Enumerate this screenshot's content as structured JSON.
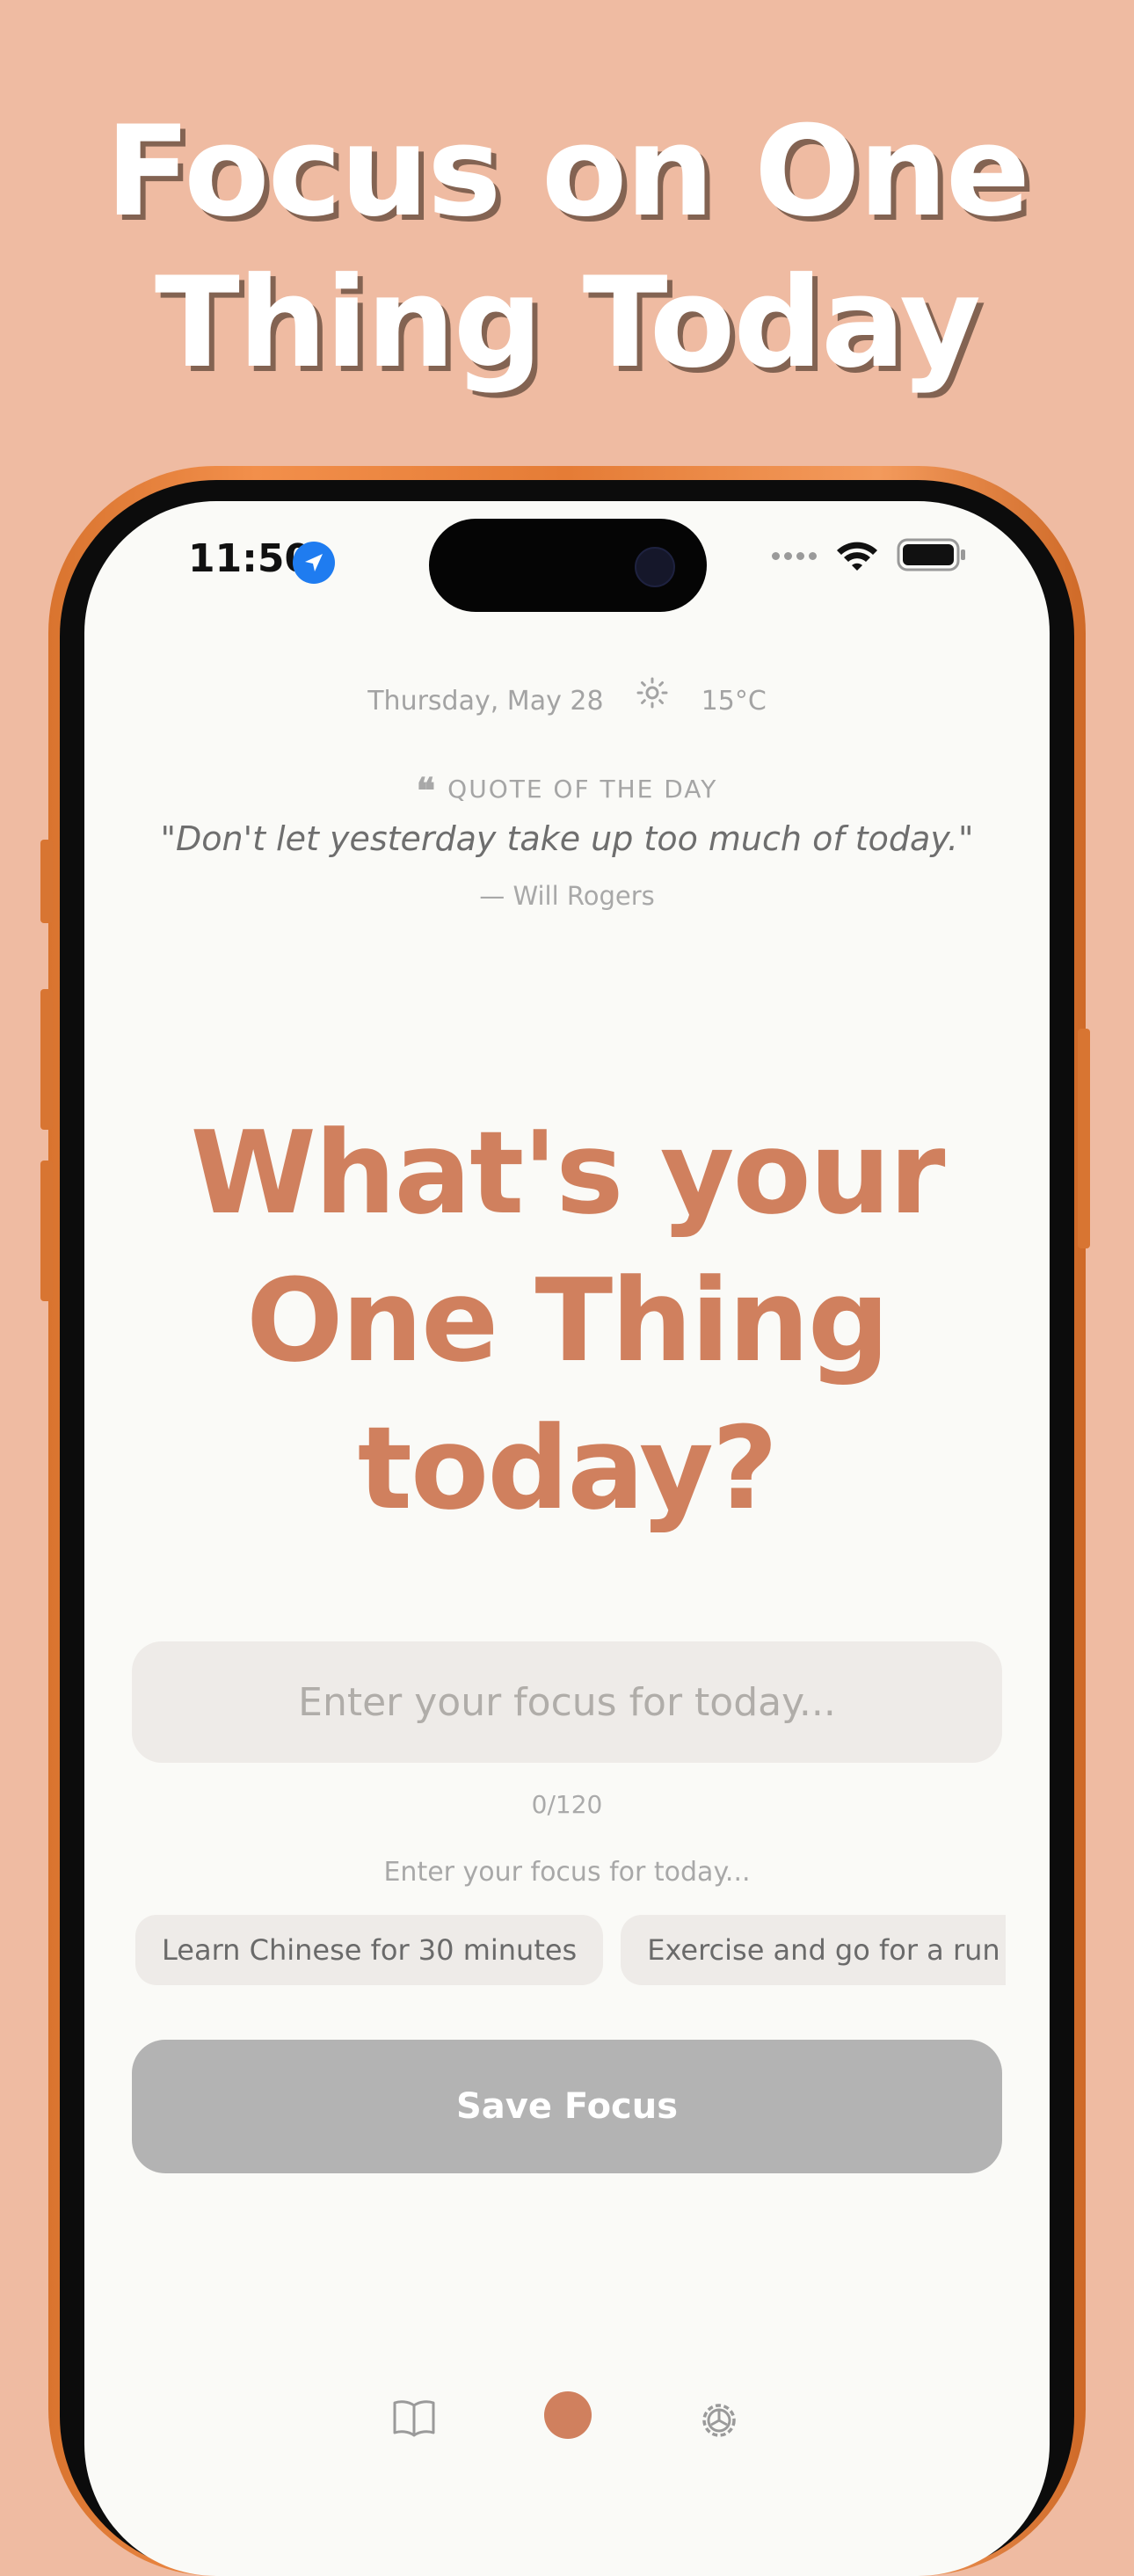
{
  "marketing": {
    "headline_line1": "Focus on One",
    "headline_line2": "Thing Today"
  },
  "status_bar": {
    "time": "11:50",
    "location_icon": "location-arrow-icon",
    "signal_icon": "signal-dots-icon",
    "wifi_icon": "wifi-icon",
    "battery_icon": "battery-icon"
  },
  "header": {
    "date": "Thursday, May 28",
    "weather_icon": "sun-icon",
    "temperature": "15°C"
  },
  "quote": {
    "label": "QUOTE OF THE DAY",
    "text": "\"Don't let yesterday take up too much of today.\"",
    "author": "— Will Rogers"
  },
  "prompt": {
    "line1": "What's your",
    "line2": "One Thing",
    "line3": "today?"
  },
  "focus_input": {
    "value": "",
    "placeholder": "Enter your focus for today...",
    "counter": "0/120"
  },
  "suggestions": {
    "hint": "Enter your focus for today...",
    "items": [
      "Learn Chinese for 30 minutes",
      "Exercise and go for a run"
    ]
  },
  "save_button": {
    "label": "Save Focus"
  },
  "tab_bar": {
    "items": [
      "book-icon",
      "focus-dot-icon",
      "gear-icon"
    ]
  },
  "colors": {
    "background": "#EFBBA2",
    "accent": "#D0805E",
    "phone_frame": "#E57C36",
    "button_disabled": "#B3B3B3"
  }
}
